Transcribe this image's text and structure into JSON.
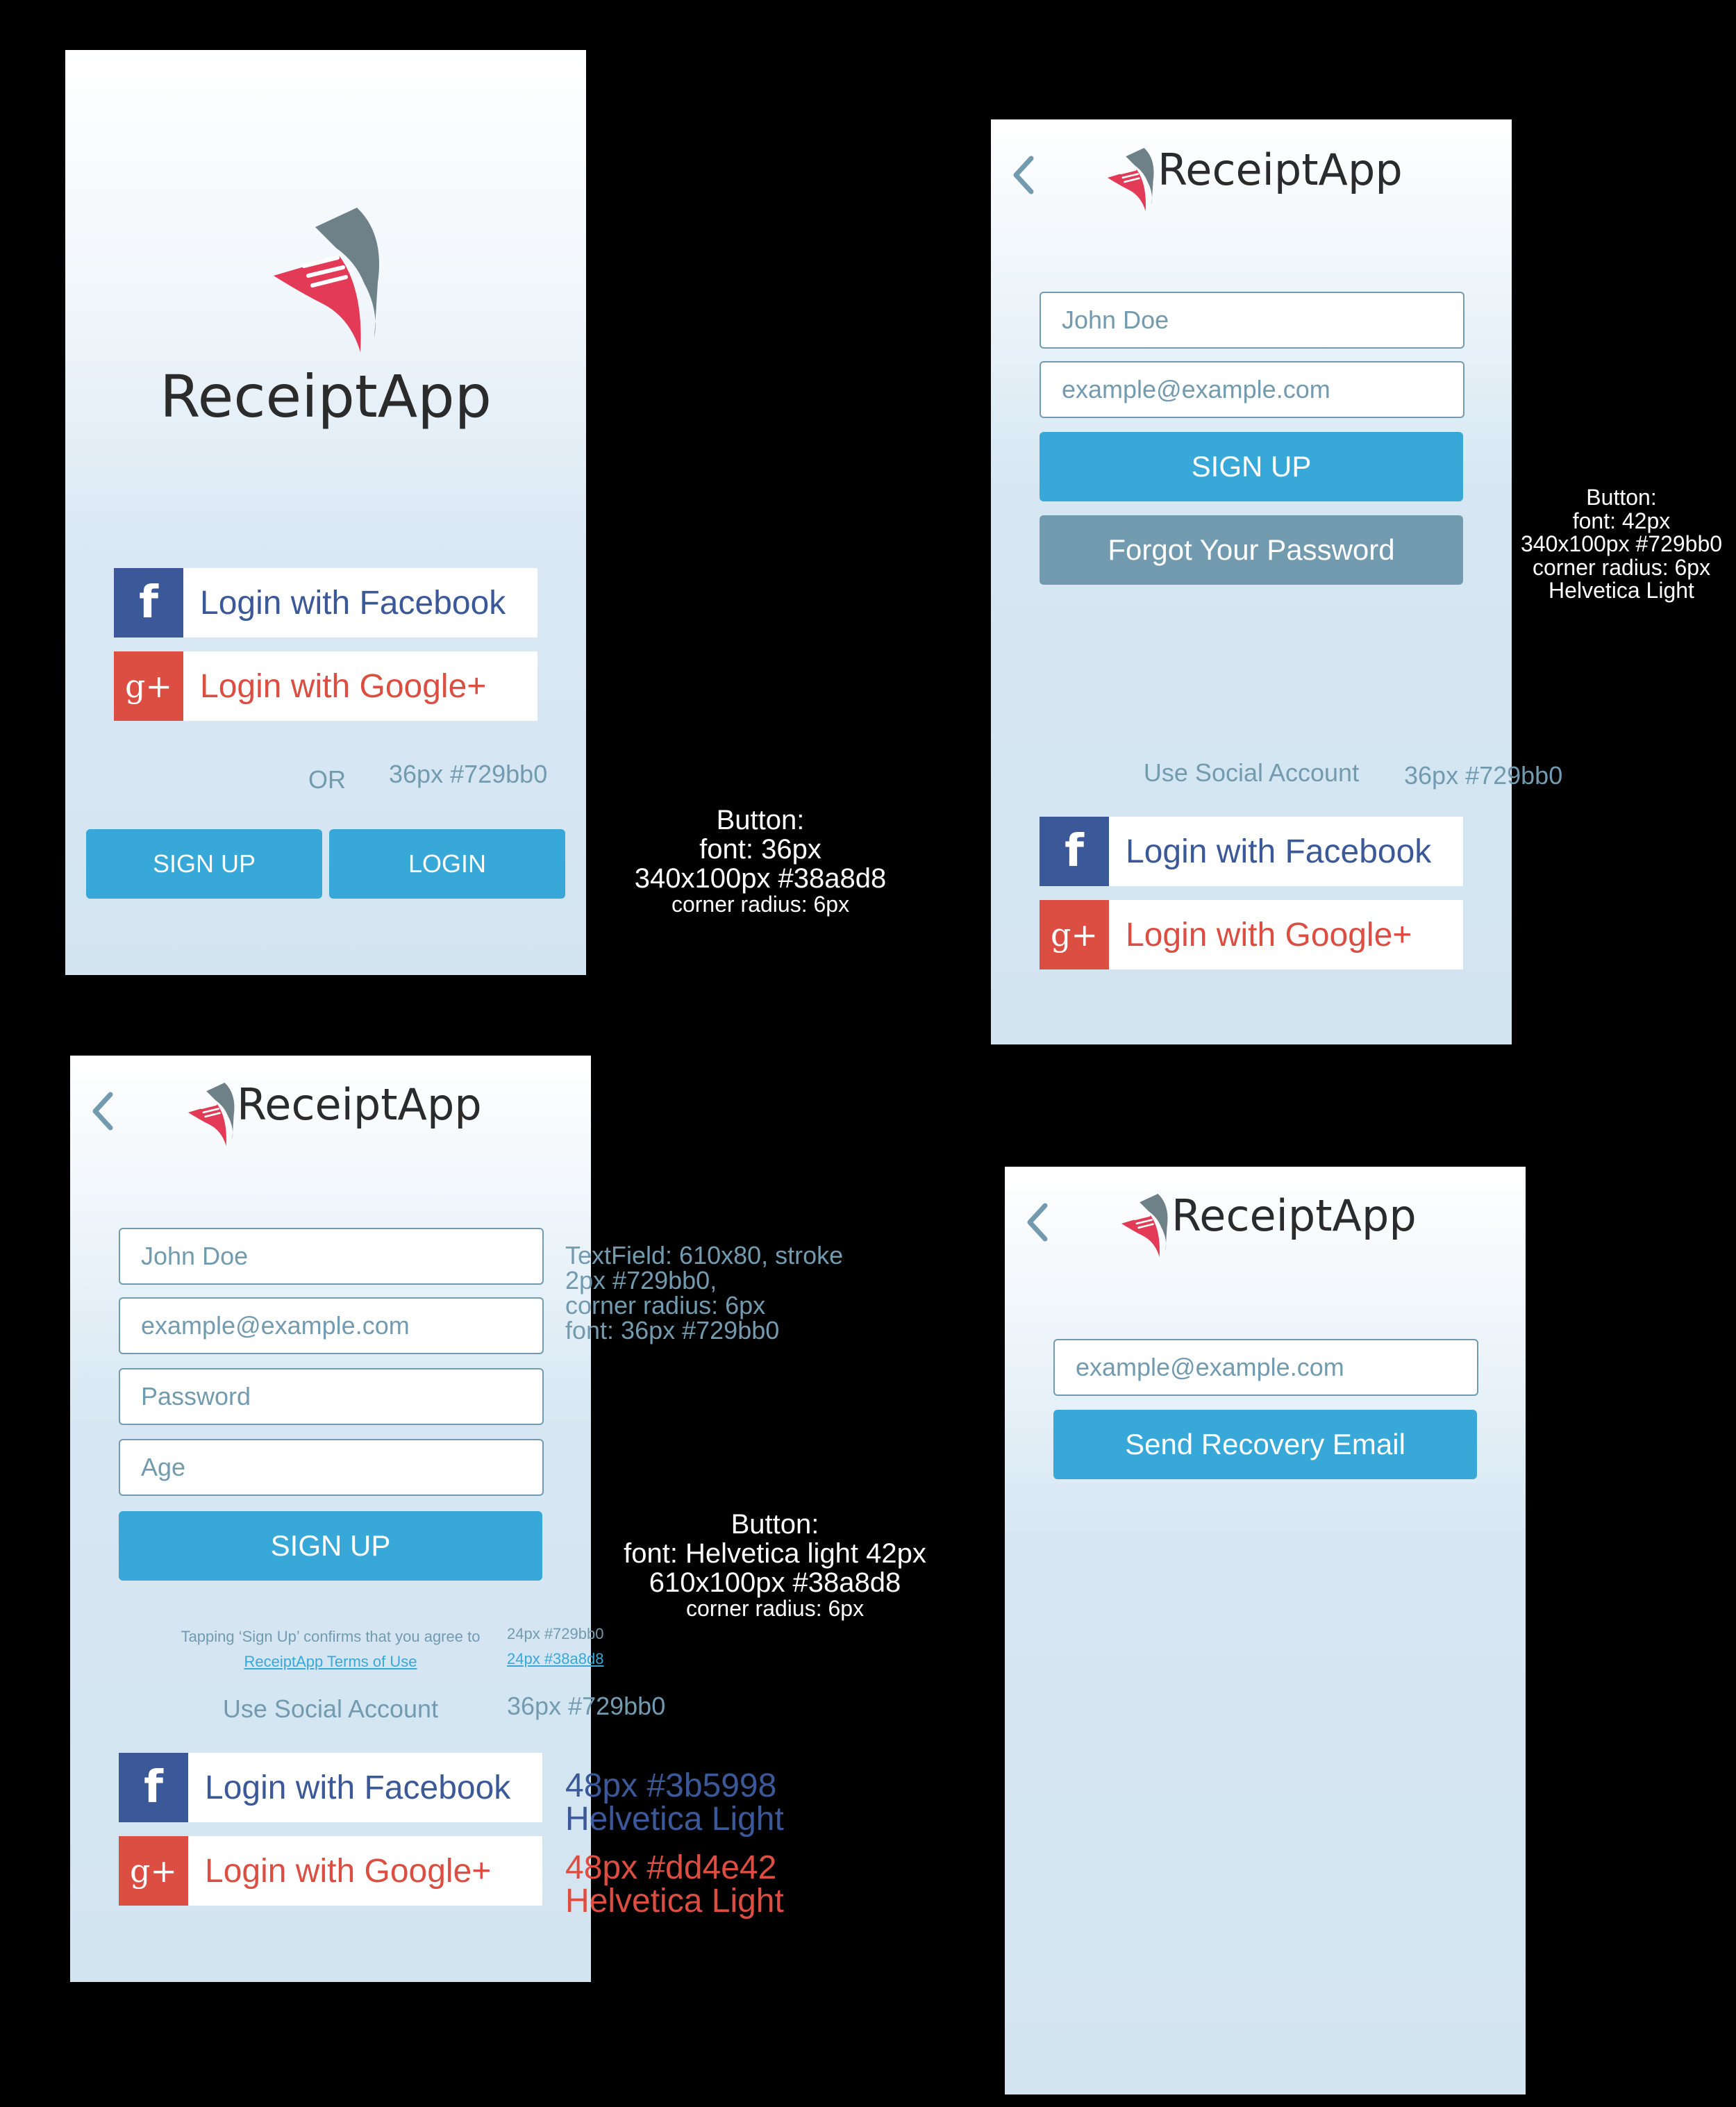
{
  "app": {
    "name": "ReceiptApp"
  },
  "colors": {
    "facebook": "#3b5998",
    "google": "#dd4e42",
    "primary_button": "#38a8d8",
    "secondary": "#729bb0"
  },
  "icons": {
    "back": "chevron-left-icon",
    "logo": "receipt-logo-icon",
    "facebook": "facebook-icon",
    "google": "google-plus-icon"
  },
  "social": {
    "facebook_label": "Login with Facebook",
    "google_label": "Login with Google+",
    "facebook_glyph": "f",
    "google_glyph": "g+"
  },
  "welcome": {
    "or_label": "OR",
    "signup_label": "SIGN UP",
    "login_label": "LOGIN"
  },
  "login": {
    "name_value": "John Doe",
    "email_value": "example@example.com",
    "signup_label": "SIGN UP",
    "forgot_label": "Forgot Your Password",
    "social_label": "Use Social Account"
  },
  "signup": {
    "name_value": "John Doe",
    "email_value": "example@example.com",
    "password_placeholder": "Password",
    "age_placeholder": "Age",
    "signup_label": "SIGN UP",
    "terms_text": "Tapping ‘Sign Up’ confirms that you agree to",
    "terms_link": "ReceiptApp Terms of Use",
    "social_label": "Use Social Account"
  },
  "recovery": {
    "email_value": "example@example.com",
    "send_label": "Send Recovery Email"
  },
  "specs": {
    "s1_or": "36px #729bb0",
    "s1_button": [
      "Button:",
      "font:  36px",
      "340x100px #38a8d8",
      "corner radius: 6px"
    ],
    "s2_button": [
      "Button:",
      "font:  42px",
      "340x100px #729bb0",
      "corner radius: 6px",
      "Helvetica Light"
    ],
    "s2_social": "36px #729bb0",
    "s3_textfield": [
      "TextField: 610x80, stroke",
      "2px #729bb0,",
      "corner radius: 6px",
      "font: 36px #729bb0"
    ],
    "s3_button": [
      "Button:",
      "font: Helvetica light 42px",
      "610x100px #38a8d8",
      "corner radius: 6px"
    ],
    "s3_terms": "24px #729bb0",
    "s3_link": "24px #38a8d8",
    "s3_social": "36px #729bb0",
    "s3_fb": [
      "48px #3b5998",
      "Helvetica Light"
    ],
    "s3_gp": [
      "48px #dd4e42",
      "Helvetica Light"
    ]
  }
}
